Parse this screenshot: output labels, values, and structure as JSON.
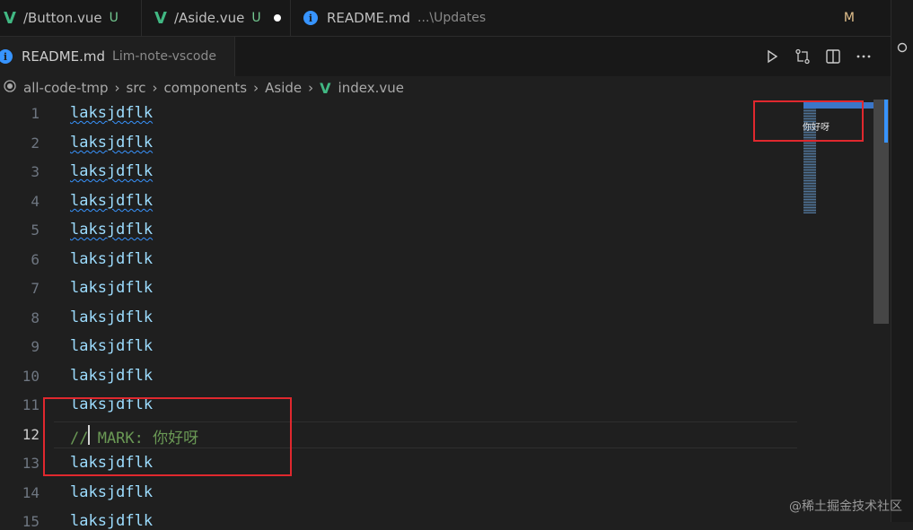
{
  "tabs": [
    {
      "label": "/Button.vue",
      "status": "U"
    },
    {
      "label": "/Aside.vue",
      "status": "U"
    },
    {
      "label": "README.md",
      "hint": "...\\Updates",
      "status": "M"
    }
  ],
  "active_tab": {
    "label": "README.md",
    "hint": "Lim-note-vscode"
  },
  "breadcrumb": [
    "all-code-tmp",
    "src",
    "components",
    "Aside",
    "index.vue"
  ],
  "editor": {
    "line_numbers": [
      "1",
      "2",
      "3",
      "4",
      "5",
      "6",
      "7",
      "8",
      "9",
      "10",
      "11",
      "12",
      "13",
      "14",
      "15"
    ],
    "lines": [
      "laksjdflk",
      "laksjdflk",
      "laksjdflk",
      "laksjdflk",
      "laksjdflk",
      "laksjdflk",
      "laksjdflk",
      "laksjdflk",
      "laksjdflk",
      "laksjdflk",
      "laksjdflk",
      "// MARK: 你好呀",
      "laksjdflk",
      "laksjdflk",
      "laksjdflk"
    ],
    "active_line": "12"
  },
  "minimap": {
    "mark_label": "你好呀"
  },
  "watermark": "@稀土掘金技术社区",
  "colors": {
    "accent": "#3794ff",
    "vue": "#41b883",
    "highlight_box": "#e0282e",
    "comment": "#6a9955"
  }
}
